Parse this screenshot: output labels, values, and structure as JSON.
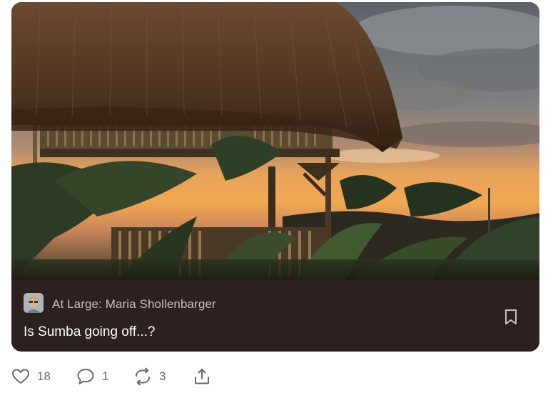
{
  "post": {
    "publication": "At Large: Maria Shollenbarger",
    "title": "Is Sumba going off...?",
    "image_alt": "Thatched hut at sunset"
  },
  "actions": {
    "likes": "18",
    "comments": "1",
    "restacks": "3"
  },
  "icons": {
    "bookmark": "bookmark-icon",
    "like": "heart-icon",
    "comment": "comment-icon",
    "restack": "restack-icon",
    "share": "share-icon"
  },
  "colors": {
    "card_footer": "#2d2120",
    "publication_text": "#c9bfbb",
    "title_text": "#ffffff",
    "action_gray": "#6a6a6a"
  }
}
